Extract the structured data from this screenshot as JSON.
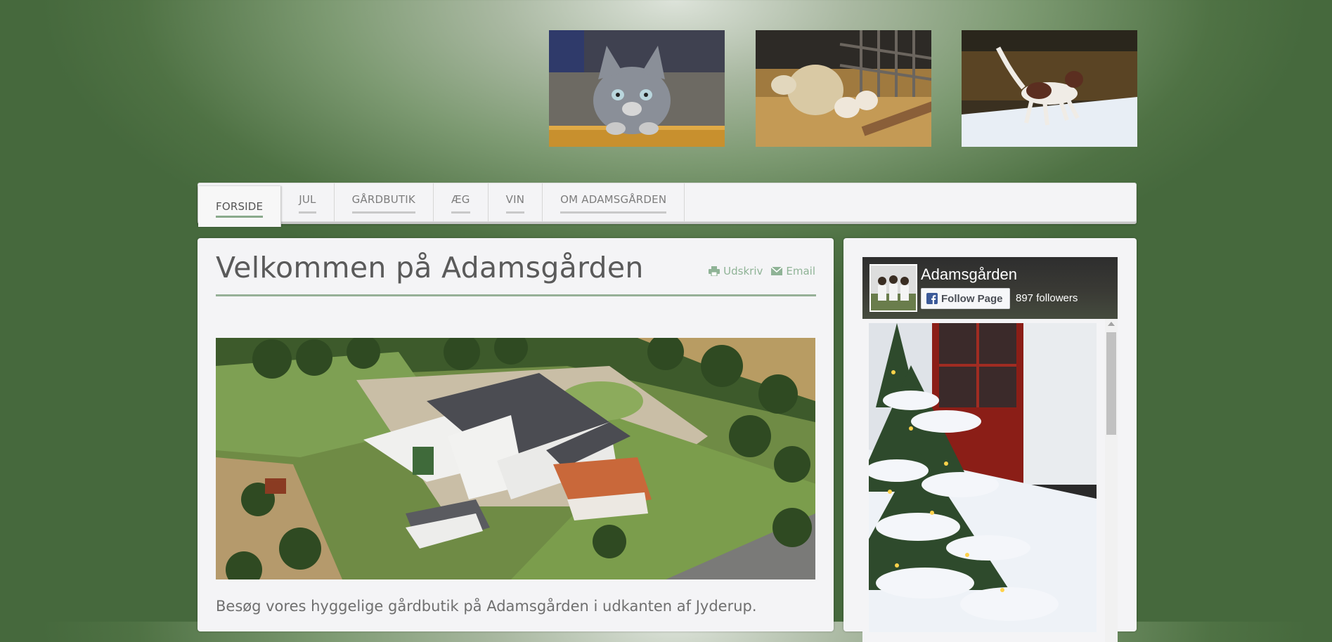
{
  "header": {
    "photos": [
      {
        "icon": "kitten-photo"
      },
      {
        "icon": "sheep-lambs-photo"
      },
      {
        "icon": "dog-in-snow-photo"
      }
    ]
  },
  "nav": {
    "items": [
      {
        "label": "FORSIDE",
        "active": true
      },
      {
        "label": "JUL",
        "active": false
      },
      {
        "label": "GÅRDBUTIK",
        "active": false
      },
      {
        "label": "ÆG",
        "active": false
      },
      {
        "label": "VIN",
        "active": false
      },
      {
        "label": "OM ADAMSGÅRDEN",
        "active": false
      }
    ]
  },
  "main": {
    "title": "Velkommen på Adamsgården",
    "print_label": "Udskriv",
    "email_label": "Email",
    "intro_text": "Besøg vores hyggelige gårdbutik på Adamsgården i udkanten af Jyderup."
  },
  "sidebar": {
    "fb": {
      "page_name": "Adamsgården",
      "follow_label": "Follow Page",
      "followers": "897 followers"
    }
  },
  "colors": {
    "accent": "#8aaa8c",
    "title_text": "#5a5a5a",
    "tool_link": "#8fb396",
    "panel_bg": "#f4f4f6",
    "page_bg": "#46693d"
  }
}
